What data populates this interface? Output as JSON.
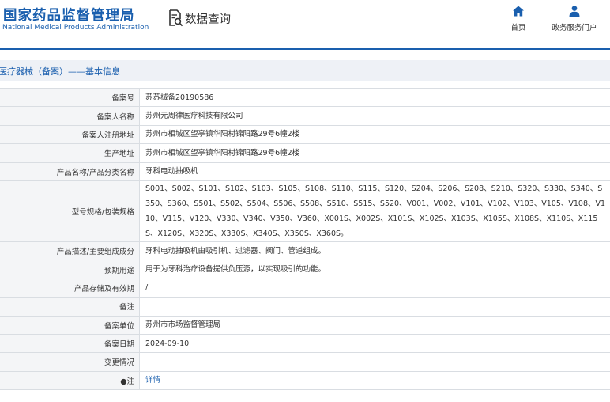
{
  "header": {
    "logo_cn": "国家药品监督管理局",
    "logo_en": "National Medical Products Administration",
    "query_title": "数据查询",
    "nav": [
      {
        "label": "首页",
        "icon": "home-icon"
      },
      {
        "label": "政务服务门户",
        "icon": "user-icon"
      }
    ]
  },
  "colors": {
    "brand": "#1a5fae",
    "label_bg": "#f4f5f7",
    "border": "#d9dde2",
    "crumb_bg": "#eef1f6"
  },
  "breadcrumb": "医疗器械（备案）——基本信息",
  "rows": [
    {
      "label": "备案号",
      "value": "苏苏械备20190586"
    },
    {
      "label": "备案人名称",
      "value": "苏州元周律医疗科技有限公司"
    },
    {
      "label": "备案人注册地址",
      "value": "苏州市相城区望亭镇华阳村锦阳路29号6幢2楼"
    },
    {
      "label": "生产地址",
      "value": "苏州市相城区望亭镇华阳村锦阳路29号6幢2楼"
    },
    {
      "label": "产品名称/产品分类名称",
      "value": "牙科电动抽吸机"
    },
    {
      "label": "型号规格/包装规格",
      "value": "S001、S002、S101、S102、S103、S105、S108、S110、S115、S120、S204、S206、S208、S210、S320、S330、S340、S350、S360、S501、S502、S504、S506、S508、S510、S515、S520、V001、V002、V101、V102、V103、V105、V108、V110、V115、V120、V330、V340、V350、V360、X001S、X002S、X101S、X102S、X103S、X105S、X108S、X110S、X115S、X120S、X320S、X330S、X340S、X350S、X360S。"
    },
    {
      "label": "产品描述/主要组成成分",
      "value": "牙科电动抽吸机由吸引机、过滤器、阀门、管道组成。"
    },
    {
      "label": "预期用途",
      "value": "用于为牙科治疗设备提供负压源，以实现吸引的功能。"
    },
    {
      "label": "产品存储及有效期",
      "value": "/"
    },
    {
      "label": "备注",
      "value": ""
    },
    {
      "label": "备案单位",
      "value": "苏州市市场监督管理局"
    },
    {
      "label": "备案日期",
      "value": "2024-09-10"
    },
    {
      "label": "变更情况",
      "value": ""
    },
    {
      "label": "●注",
      "value": "详情"
    }
  ]
}
